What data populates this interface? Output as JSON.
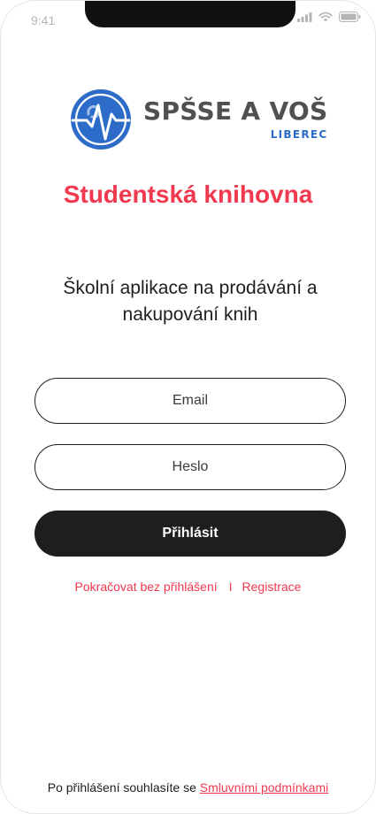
{
  "status_bar": {
    "time": "9:41"
  },
  "logo": {
    "name": "SPŠSE A VOŠ",
    "city": "LIBEREC"
  },
  "app": {
    "title": "Studentská knihovna",
    "subtitle": "Školní aplikace na prodávání a nakupování knih"
  },
  "form": {
    "email_placeholder": "Email",
    "password_placeholder": "Heslo",
    "login_label": "Přihlásit"
  },
  "links": {
    "continue_without_login": "Pokračovat bez přihlášení",
    "separator": "I",
    "register": "Registrace"
  },
  "footer": {
    "text": "Po přihlášení souhlasíte se",
    "terms_link": "Smluvními podmínkami"
  },
  "colors": {
    "accent": "#f0394f",
    "button_bg": "#1e1e1e",
    "logo_blue": "#2c6cc8",
    "logo_gray": "#505050"
  },
  "icons": {
    "signal": "signal-icon",
    "wifi": "wifi-icon",
    "battery": "battery-icon",
    "logo": "heartbeat-emblem-icon"
  }
}
